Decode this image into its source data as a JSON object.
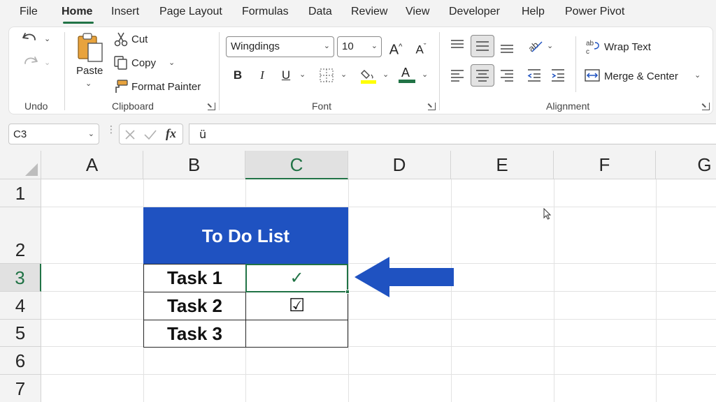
{
  "menu": {
    "tabs": [
      "File",
      "Home",
      "Insert",
      "Page Layout",
      "Formulas",
      "Data",
      "Review",
      "View",
      "Developer",
      "Help",
      "Power Pivot"
    ],
    "active": "Home"
  },
  "ribbon": {
    "undo_group": {
      "label": "Undo"
    },
    "clipboard": {
      "label": "Clipboard",
      "paste": "Paste",
      "cut": "Cut",
      "copy": "Copy",
      "format_painter": "Format Painter"
    },
    "font": {
      "label": "Font",
      "font_name": "Wingdings",
      "font_size": "10",
      "bold": "B",
      "italic": "I",
      "underline": "U",
      "grow": "A",
      "shrink": "A",
      "font_color_glyph": "A",
      "highlight_color": "#ffff00",
      "font_color": "#c00000"
    },
    "alignment": {
      "label": "Alignment",
      "wrap_text": "Wrap Text",
      "merge_center": "Merge & Center"
    }
  },
  "formula_bar": {
    "name_box": "C3",
    "fx": "fx",
    "formula": "ü"
  },
  "grid": {
    "columns": [
      "A",
      "B",
      "C",
      "D",
      "E",
      "F",
      "G"
    ],
    "rows": [
      "1",
      "2",
      "3",
      "4",
      "5",
      "6",
      "7"
    ],
    "selected_column": "C",
    "selected_row": "3",
    "table_header": "To Do List",
    "tasks": [
      "Task 1",
      "Task 2",
      "Task 3"
    ],
    "marks": [
      "✓",
      "☑",
      ""
    ],
    "header_color": "#1f52c1",
    "check_color": "#217346",
    "arrow_color": "#1f52c1"
  }
}
